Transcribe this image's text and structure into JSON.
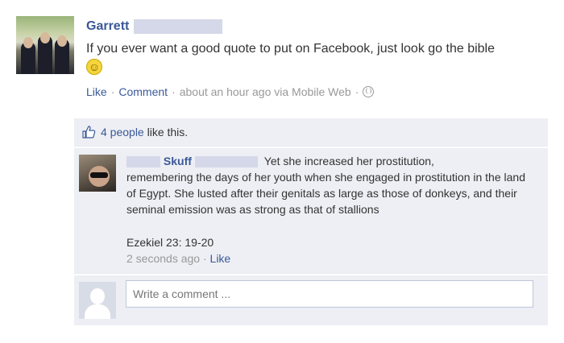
{
  "post": {
    "author_first": "Garrett",
    "text": "If you ever want a good quote to put on Facebook, just look go the bible",
    "emoji": "smiley",
    "actions": {
      "like": "Like",
      "comment": "Comment"
    },
    "timestamp": "about an hour ago via Mobile Web",
    "sep": "·"
  },
  "ufi": {
    "likes_count": "4 people",
    "likes_suffix": "like this."
  },
  "comment": {
    "author": "Skuff",
    "text_lead": "Yet she increased her prostitution,",
    "text_body": "remembering the days of her youth when she engaged in prostitution in the land of Egypt. She lusted after their genitals as large as those of donkeys, and their seminal emission was as strong as that of stallions",
    "reference": "Ezekiel 23: 19-20",
    "time": "2 seconds ago",
    "like": "Like"
  },
  "composer": {
    "placeholder": "Write a comment ..."
  },
  "colors": {
    "link": "#3b5998",
    "ufi_bg": "#edeff4",
    "meta": "#999999",
    "redaction": "#d4d8e8"
  }
}
